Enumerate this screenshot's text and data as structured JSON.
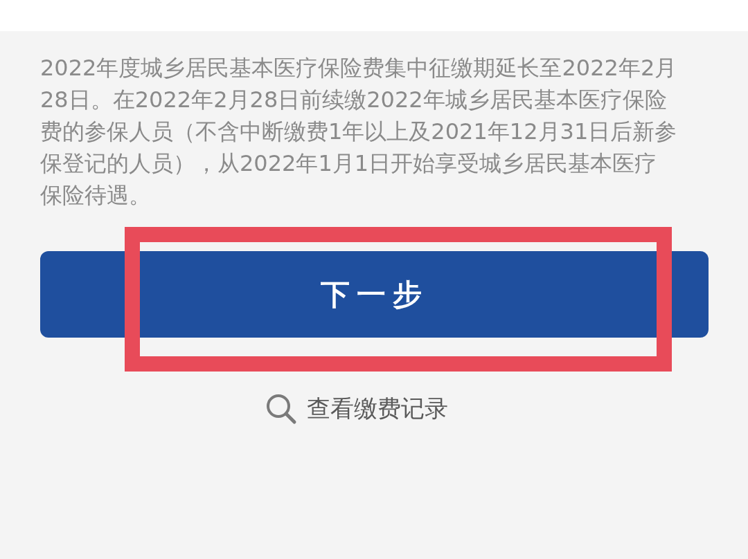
{
  "notice": {
    "text": "2022年度城乡居民基本医疗保险费集中征缴期延长至2022年2月28日。在2022年2月28日前续缴2022年城乡居民基本医疗保险费的参保人员（不含中断缴费1年以上及2021年12月31日后新参保登记的人员），从2022年1月1日开始享受城乡居民基本医疗保险待遇。"
  },
  "next_button": {
    "label": "下一步",
    "highlighted": true
  },
  "records_link": {
    "label": "查看缴费记录"
  }
}
